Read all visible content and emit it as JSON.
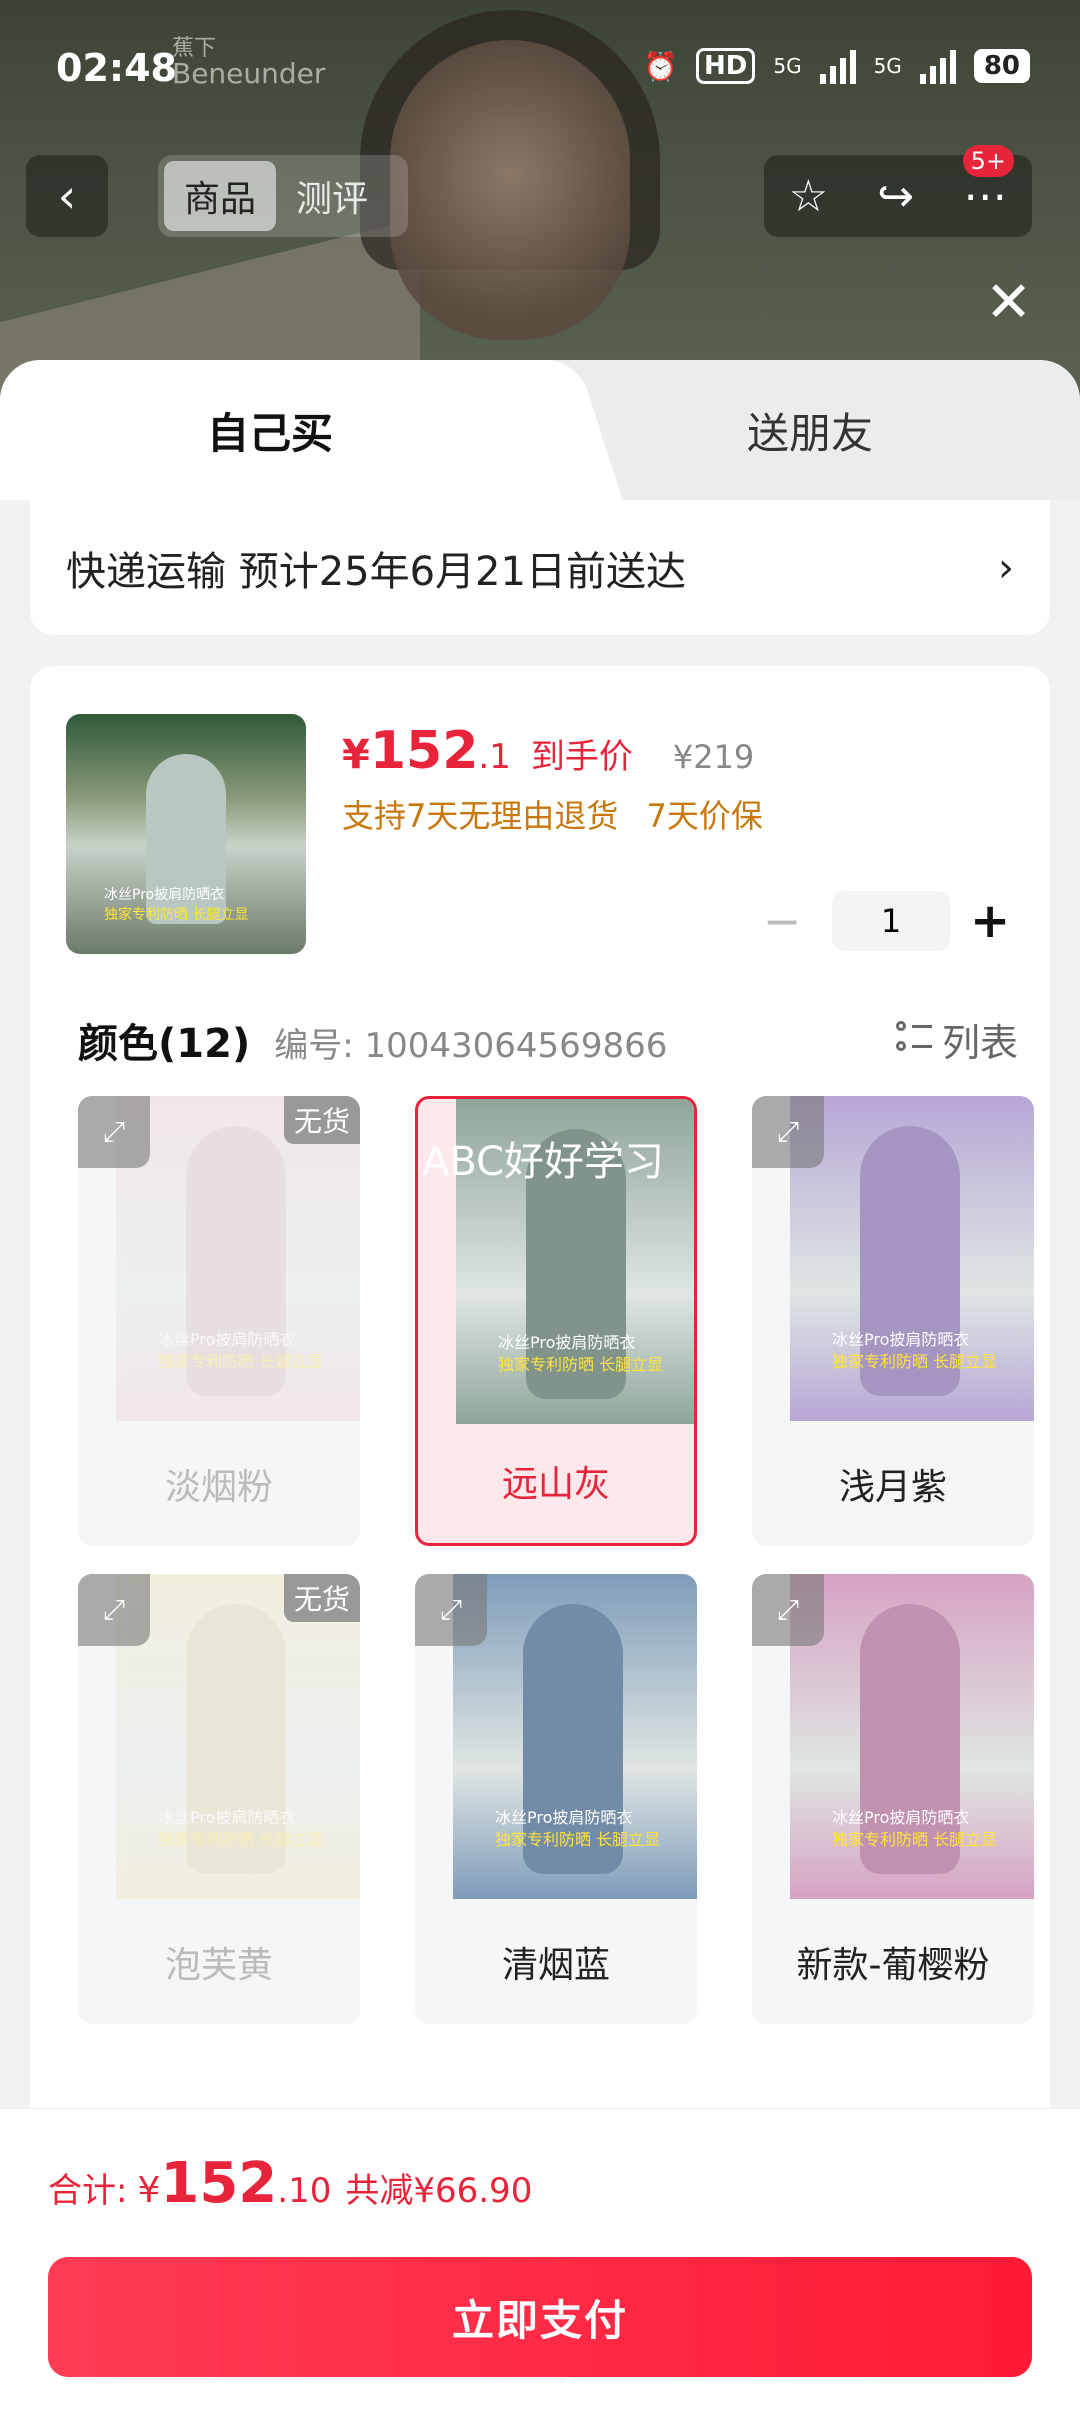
{
  "status": {
    "time": "02:48",
    "brand_cn": "蕉下",
    "brand": "Beneunder",
    "hd": "HD",
    "net1": "5G",
    "net2": "5G",
    "battery": "80"
  },
  "nav": {
    "tabs": [
      {
        "label": "商品",
        "active": true
      },
      {
        "label": "测评",
        "active": false
      }
    ],
    "badge": "5+"
  },
  "buy_tabs": [
    {
      "label": "自己买",
      "active": true
    },
    {
      "label": "送朋友",
      "active": false
    }
  ],
  "shipping": {
    "text": "快递运输 预计25年6月21日前送达"
  },
  "product": {
    "price_symbol": "¥",
    "price_int": "152",
    "price_dec": ".1",
    "price_tag": "到手价",
    "original_price": "¥219",
    "policy": [
      "支持7天无理由退货",
      "7天价保"
    ],
    "thumb_text_1": "冰丝Pro披肩防晒衣",
    "thumb_text_2": "独家专利防晒 长腿立显",
    "quantity": "1"
  },
  "colors": {
    "title": "颜色(12)",
    "sku": "编号: 10043064569866",
    "view_toggle": "列表",
    "overlay_text": "ABC好好学习",
    "oos_tag": "无货",
    "items": [
      {
        "name": "淡烟粉",
        "status": "oos",
        "img_color": "#e9c9cf"
      },
      {
        "name": "远山灰",
        "status": "selected",
        "img_color": "#8fa59a"
      },
      {
        "name": "浅月紫",
        "status": "normal",
        "img_color": "#b7a7d6"
      },
      {
        "name": "泡芙黄",
        "status": "oos",
        "img_color": "#efe2b0"
      },
      {
        "name": "清烟蓝",
        "status": "normal",
        "img_color": "#7f9cba"
      },
      {
        "name": "新款-葡樱粉",
        "status": "normal",
        "img_color": "#d6a2c2"
      }
    ],
    "item_text_1": "冰丝Pro披肩防晒衣",
    "item_text_2": "独家专利防晒 长腿立显"
  },
  "footer": {
    "total_label": "合计:",
    "total_symbol": "¥",
    "total_int": "152",
    "total_dec": ".10",
    "savings": "共减¥66.90",
    "pay_button": "立即支付"
  }
}
